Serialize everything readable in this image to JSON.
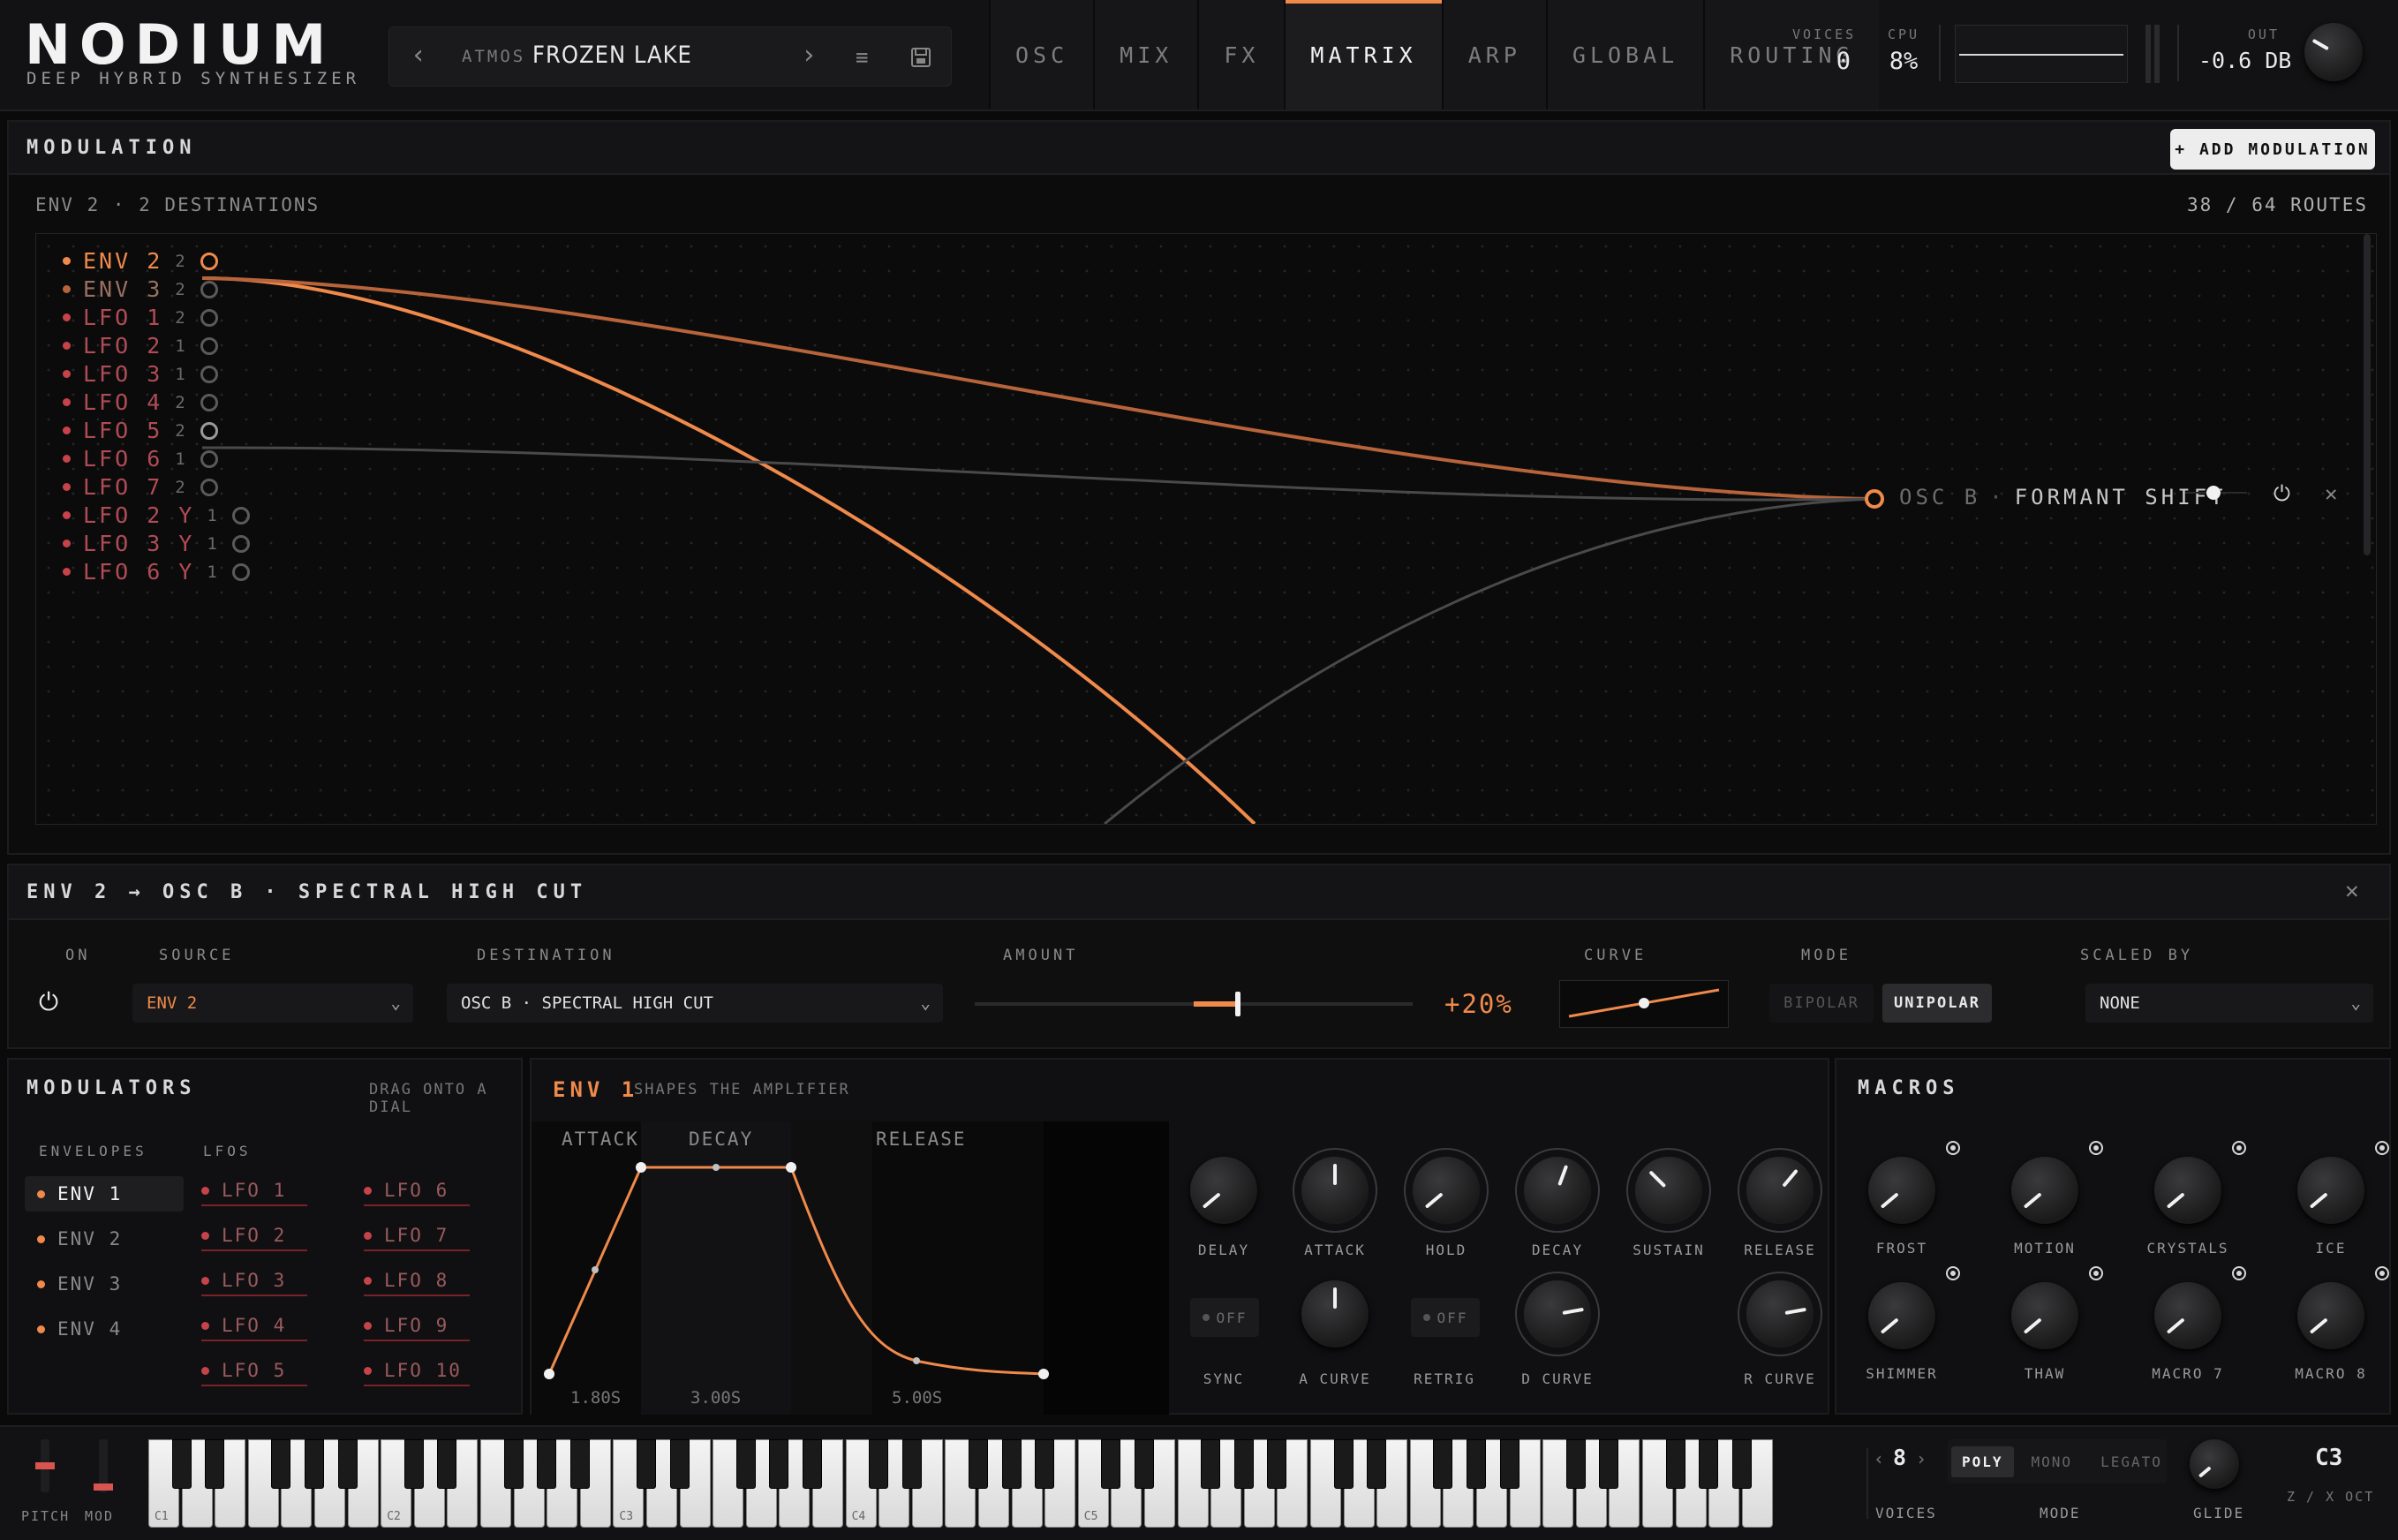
{
  "header": {
    "logo": "NODIUM",
    "logo_sub": "DEEP HYBRID SYNTHESIZER",
    "preset_bank": "ATMOS",
    "preset_name": "FROZEN LAKE",
    "tabs": [
      "OSC",
      "MIX",
      "FX",
      "MATRIX",
      "ARP",
      "GLOBAL",
      "ROUTING"
    ],
    "active_tab": "MATRIX",
    "voices_label": "VOICES",
    "voices_value": "0",
    "cpu_label": "CPU",
    "cpu_value": "8%",
    "out_label": "OUT",
    "out_value": "-0.6 DB"
  },
  "modulation": {
    "title": "MODULATION",
    "add_button": "+ ADD MODULATION",
    "source_summary": "ENV 2 · 2 DESTINATIONS",
    "routes": "38 / 64 ROUTES",
    "sources": [
      {
        "name": "ENV 2",
        "count": "2",
        "active": true
      },
      {
        "name": "ENV 3",
        "count": "2"
      },
      {
        "name": "LFO 1",
        "count": "2"
      },
      {
        "name": "LFO 2",
        "count": "1"
      },
      {
        "name": "LFO 3",
        "count": "1"
      },
      {
        "name": "LFO 4",
        "count": "2"
      },
      {
        "name": "LFO 5",
        "count": "2"
      },
      {
        "name": "LFO 6",
        "count": "1"
      },
      {
        "name": "LFO 7",
        "count": "2"
      },
      {
        "name": "LFO 2 Y",
        "count": "1"
      },
      {
        "name": "LFO 3 Y",
        "count": "1"
      },
      {
        "name": "LFO 6 Y",
        "count": "1"
      }
    ],
    "destination_module": "OSC B",
    "destination_param": "FORMANT SHIFT"
  },
  "detail": {
    "title": "ENV 2 → OSC B · SPECTRAL HIGH CUT",
    "on_label": "ON",
    "source_label": "SOURCE",
    "source_value": "ENV 2",
    "destination_label": "DESTINATION",
    "destination_value": "OSC B · SPECTRAL HIGH CUT",
    "amount_label": "AMOUNT",
    "amount_value": "+20%",
    "amount_fraction": 0.6,
    "curve_label": "CURVE",
    "mode_label": "MODE",
    "mode_bipolar": "BIPOLAR",
    "mode_unipolar": "UNIPOLAR",
    "scaled_label": "SCALED BY",
    "scaled_value": "NONE"
  },
  "modulators": {
    "title": "MODULATORS",
    "hint": "DRAG ONTO A DIAL",
    "envelopes_label": "ENVELOPES",
    "lfos_label": "LFOS",
    "envelopes": [
      "ENV 1",
      "ENV 2",
      "ENV 3",
      "ENV 4"
    ],
    "lfos_a": [
      "LFO 1",
      "LFO 2",
      "LFO 3",
      "LFO 4",
      "LFO 5"
    ],
    "lfos_b": [
      "LFO 6",
      "LFO 7",
      "LFO 8",
      "LFO 9",
      "LFO 10"
    ]
  },
  "env": {
    "name": "ENV 1",
    "subtitle": "SHAPES THE AMPLIFIER",
    "stage_attack": "ATTACK",
    "stage_decay": "DECAY",
    "stage_release": "RELEASE",
    "time_attack": "1.80S",
    "time_decay": "3.00S",
    "time_release": "5.00S",
    "knobs": [
      "DELAY",
      "ATTACK",
      "HOLD",
      "DECAY",
      "SUSTAIN",
      "RELEASE"
    ],
    "sync_label": "SYNC",
    "retrig_label": "RETRIG",
    "off": "OFF",
    "a_curve": "A CURVE",
    "d_curve": "D CURVE",
    "r_curve": "R CURVE"
  },
  "macros": {
    "title": "MACROS",
    "names": [
      "FROST",
      "MOTION",
      "CRYSTALS",
      "ICE",
      "SHIMMER",
      "THAW",
      "MACRO 7",
      "MACRO 8"
    ]
  },
  "keyboard": {
    "pitch_label": "PITCH",
    "mod_label": "MOD",
    "octaves": [
      "C1",
      "C2",
      "C3",
      "C4",
      "C5"
    ],
    "voices_value": "8",
    "voices_label": "VOICES",
    "mode_label": "MODE",
    "modes": [
      "POLY",
      "MONO",
      "LEGATO"
    ],
    "active_mode": "POLY",
    "glide_label": "GLIDE",
    "octave_note": "C3",
    "octave_hint": "Z / X OCT"
  },
  "colors": {
    "accent": "#f08a4b",
    "source_red": "#c7434a",
    "background": "#0a0a0b"
  }
}
